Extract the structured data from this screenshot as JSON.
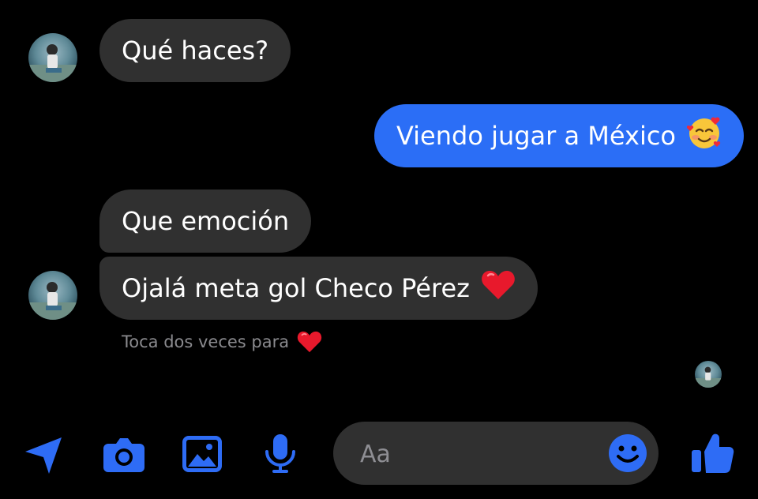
{
  "messages": [
    {
      "sender": "contact",
      "text": "Qué haces?"
    },
    {
      "sender": "me",
      "text": "Viendo jugar a México",
      "emoji": "smiling-face-with-hearts"
    },
    {
      "sender": "contact",
      "text": "Que emoción"
    },
    {
      "sender": "contact",
      "text": "Ojalá meta gol Checo Pérez",
      "emoji": "red-heart"
    }
  ],
  "hint": {
    "text": "Toca dos veces para",
    "emoji": "red-heart"
  },
  "composer": {
    "placeholder": "Aa"
  },
  "toolbar": {
    "icons": [
      "location-arrow-icon",
      "camera-icon",
      "image-icon",
      "microphone-icon",
      "emoji-icon",
      "thumbs-up-icon"
    ]
  },
  "colors": {
    "background": "#000000",
    "incoming_bubble": "#303030",
    "outgoing_bubble": "#2b6ef6",
    "accent": "#2e6cf5",
    "hint_text": "#8a8a8e"
  }
}
